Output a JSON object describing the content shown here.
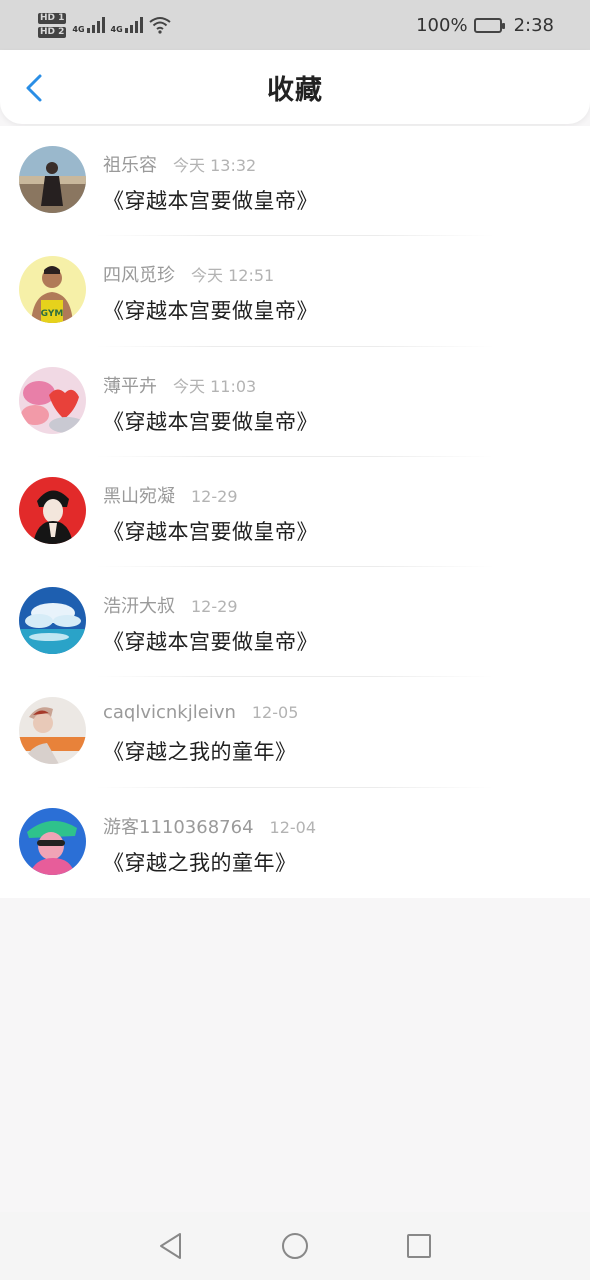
{
  "status_bar": {
    "hd1": "HD 1",
    "hd2": "HD 2",
    "net1": "4G",
    "net2": "4G",
    "battery": "100%",
    "time": "2:38"
  },
  "header": {
    "title": "收藏",
    "back_icon": "chevron-left-icon",
    "accent_color": "#2a8ee6"
  },
  "favorites": [
    {
      "name": "祖乐容",
      "time": "今天 13:32",
      "book": "《穿越本宫要做皇帝》"
    },
    {
      "name": "四风觅珍",
      "time": "今天 12:51",
      "book": "《穿越本宫要做皇帝》"
    },
    {
      "name": "薄平卉",
      "time": "今天 11:03",
      "book": "《穿越本宫要做皇帝》"
    },
    {
      "name": "黑山宛凝",
      "time": "12-29",
      "book": "《穿越本宫要做皇帝》"
    },
    {
      "name": "浩汧大叔",
      "time": "12-29",
      "book": "《穿越本宫要做皇帝》"
    },
    {
      "name": "caqlvicnkjleivn",
      "time": "12-05",
      "book": "《穿越之我的童年》"
    },
    {
      "name": "游客1110368764",
      "time": "12-04",
      "book": "《穿越之我的童年》"
    }
  ],
  "nav_bar": {
    "back": "triangle-back-icon",
    "home": "circle-home-icon",
    "recents": "square-recents-icon"
  }
}
